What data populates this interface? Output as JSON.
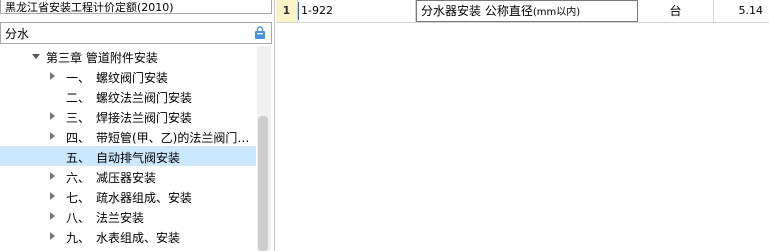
{
  "quota_library": "黑龙江省安装工程计价定额(2010)",
  "search": {
    "value": "分水",
    "icon": "bag-search-icon"
  },
  "tree": {
    "chapter": {
      "label": "第三章  管道附件安装",
      "expanded": true
    },
    "items": [
      {
        "num": "一、",
        "label": "螺纹阀门安装",
        "has_children": true,
        "selected": false
      },
      {
        "num": "二、",
        "label": "螺纹法兰阀门安装",
        "has_children": false,
        "selected": false
      },
      {
        "num": "三、",
        "label": "焊接法兰阀门安装",
        "has_children": true,
        "selected": false
      },
      {
        "num": "四、",
        "label": "带短管(甲、乙)的法兰阀门…",
        "has_children": true,
        "selected": false
      },
      {
        "num": "五、",
        "label": "自动排气阀安装",
        "has_children": false,
        "selected": true
      },
      {
        "num": "六、",
        "label": "减压器安装",
        "has_children": true,
        "selected": false
      },
      {
        "num": "七、",
        "label": "疏水器组成、安装",
        "has_children": true,
        "selected": false
      },
      {
        "num": "八、",
        "label": "法兰安装",
        "has_children": true,
        "selected": false
      },
      {
        "num": "九、",
        "label": "水表组成、安装",
        "has_children": true,
        "selected": false
      }
    ]
  },
  "grid": {
    "rows": [
      {
        "index": "1",
        "code": "1-922",
        "name": "分水器安装 公称直径",
        "name_suffix": "(mm以内)",
        "unit": "台",
        "quantity": "5.14"
      }
    ]
  },
  "colors": {
    "selected_row": "#cce8ff",
    "index_cell": "#fdf3c8",
    "search_icon": "#4a90d9"
  }
}
